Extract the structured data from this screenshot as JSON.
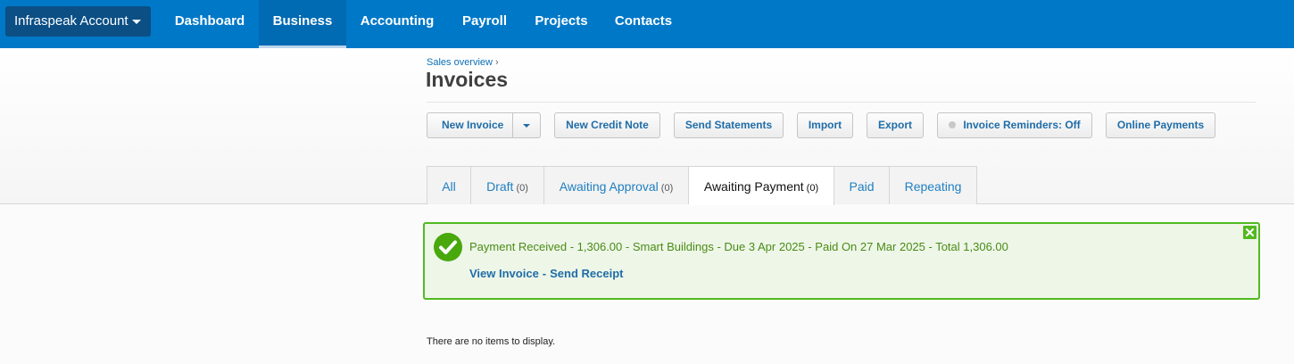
{
  "topnav": {
    "org_label": "Infraspeak Account",
    "items": [
      "Dashboard",
      "Business",
      "Accounting",
      "Payroll",
      "Projects",
      "Contacts"
    ],
    "active": "Business"
  },
  "breadcrumb": {
    "parent": "Sales overview",
    "separator": "›"
  },
  "page": {
    "title": "Invoices"
  },
  "toolbar": {
    "new_invoice": "New Invoice",
    "new_credit_note": "New Credit Note",
    "send_statements": "Send Statements",
    "import": "Import",
    "export": "Export",
    "invoice_reminders": "Invoice Reminders: Off",
    "online_payments": "Online Payments"
  },
  "tabs": [
    {
      "label": "All",
      "count": ""
    },
    {
      "label": "Draft",
      "count": "(0)"
    },
    {
      "label": "Awaiting Approval",
      "count": "(0)"
    },
    {
      "label": "Awaiting Payment",
      "count": "(0)"
    },
    {
      "label": "Paid",
      "count": ""
    },
    {
      "label": "Repeating",
      "count": ""
    }
  ],
  "active_tab": "Awaiting Payment",
  "notice": {
    "message": "Payment Received - 1,306.00 - Smart Buildings - Due 3 Apr 2025 - Paid On 27 Mar 2025 - Total 1,306.00",
    "view_invoice": "View Invoice",
    "link_separator": "-",
    "send_receipt": "Send Receipt"
  },
  "empty_message": "There are no items to display.",
  "colors": {
    "nav_bg": "#0078c8",
    "success_border": "#52b920",
    "link": "#1f6da8"
  }
}
